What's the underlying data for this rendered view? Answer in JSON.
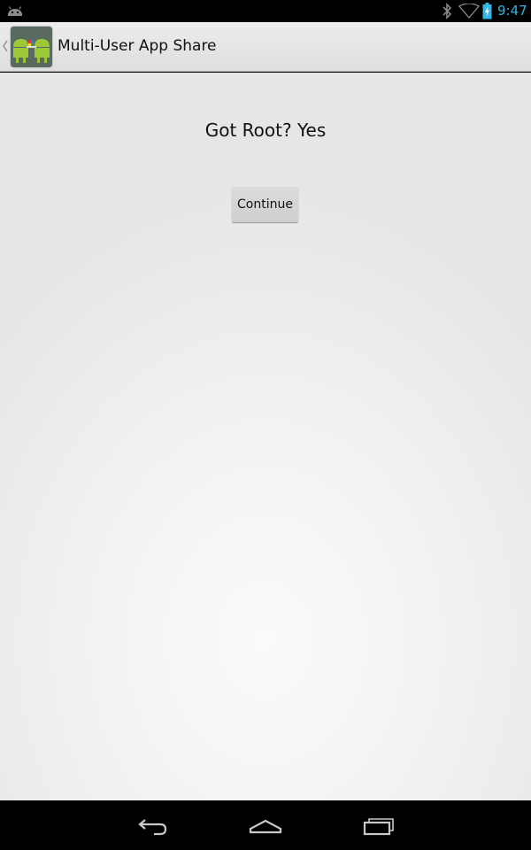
{
  "status_bar": {
    "time": "9:47",
    "icons": [
      "android-notification-icon",
      "bluetooth-icon",
      "wifi-icon",
      "battery-charging-icon"
    ],
    "accent_color": "#33b5e5"
  },
  "action_bar": {
    "title": "Multi-User App Share",
    "icon": "app-launcher-icon"
  },
  "content": {
    "root_status": "Got Root? Yes",
    "continue_label": "Continue"
  },
  "nav_bar": {
    "buttons": [
      "back-icon",
      "home-icon",
      "recents-icon"
    ]
  }
}
